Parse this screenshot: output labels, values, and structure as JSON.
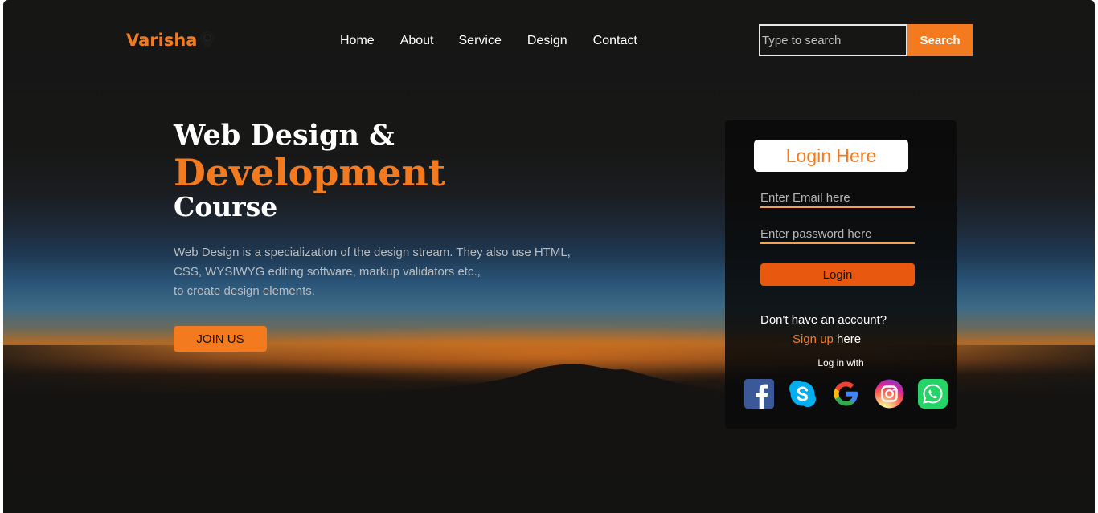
{
  "brand": {
    "name": "Varisha",
    "icon": "lightbulb-icon",
    "color": "#f47a1f"
  },
  "nav": {
    "items": [
      {
        "label": "Home"
      },
      {
        "label": "About"
      },
      {
        "label": "Service"
      },
      {
        "label": "Design"
      },
      {
        "label": "Contact"
      }
    ]
  },
  "search": {
    "placeholder": "Type to search",
    "button_label": "Search"
  },
  "hero": {
    "line1": "Web Design &",
    "line2": "Development",
    "line3": "Course",
    "description_lines": [
      "Web Design is a specialization of the design stream. They also use HTML,",
      "CSS, WYSIWYG editing software, markup validators etc.,",
      "to create design elements."
    ],
    "cta_label": "JOIN US"
  },
  "login": {
    "title": "Login Here",
    "email_placeholder": "Enter Email here",
    "password_placeholder": "Enter password here",
    "button_label": "Login",
    "no_account_text": "Don't have an account?",
    "signup_link": "Sign up",
    "signup_suffix": " here",
    "login_with": "Log in with",
    "socials": [
      "facebook-icon",
      "skype-icon",
      "google-icon",
      "instagram-icon",
      "whatsapp-icon"
    ]
  },
  "colors": {
    "accent": "#f47a1f",
    "login_button": "#e8590f",
    "background": "#161615"
  }
}
